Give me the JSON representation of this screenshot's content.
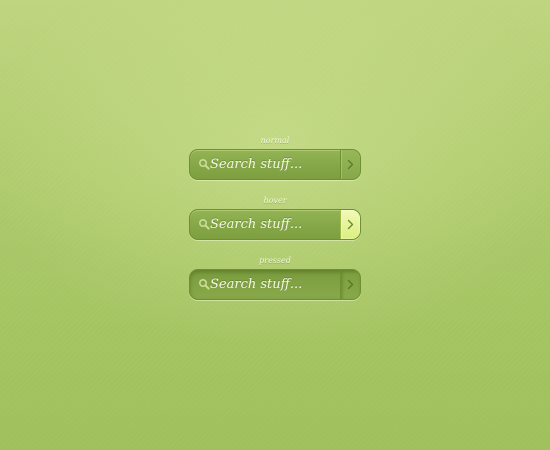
{
  "states": {
    "normal": {
      "label": "normal",
      "search_placeholder": "Search stuff..."
    },
    "hover": {
      "label": "hover",
      "search_placeholder": "Search stuff..."
    },
    "pressed": {
      "label": "pressed",
      "search_placeholder": "Search stuff..."
    }
  },
  "icons": {
    "search": "search-icon",
    "submit": "chevron-right-icon"
  },
  "colors": {
    "background": "#b2cd70",
    "bar_fill": "#88a94a",
    "bar_border": "#6f8f33",
    "text": "#f4f8e4",
    "hover_button": "#e6f39a"
  }
}
